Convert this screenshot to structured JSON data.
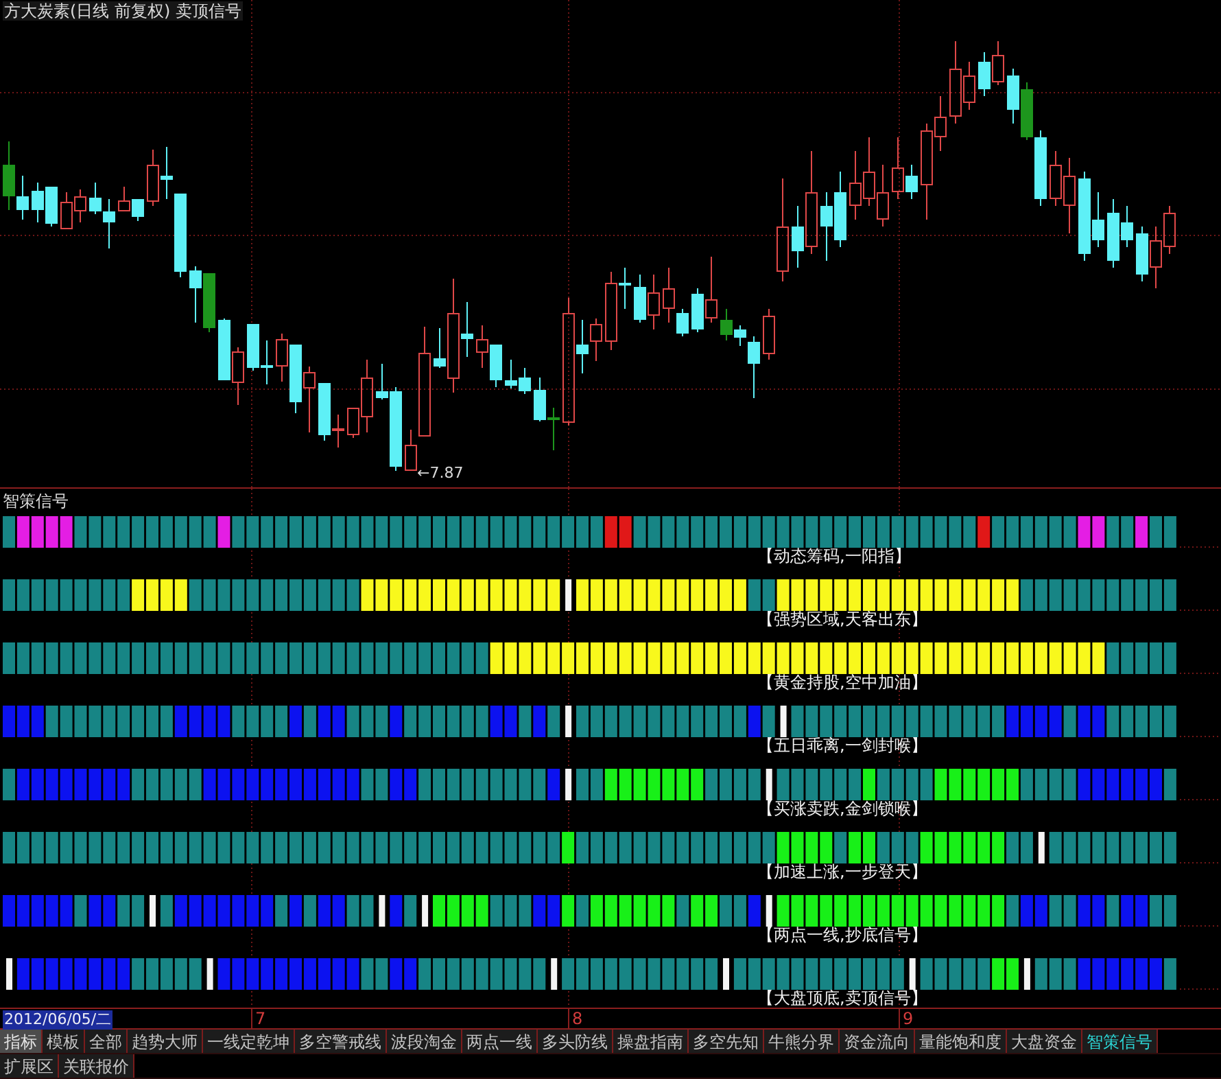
{
  "chart_window": {
    "title": "方大炭素(日线 前复权) 卖顶信号",
    "low_marker": "←7.87"
  },
  "signal_panel": {
    "title": "智策信号",
    "signals": [
      {
        "label": "【动态筹码,一阳指】"
      },
      {
        "label": "【强势区域,天客出东】"
      },
      {
        "label": "【黄金持股,空中加油】"
      },
      {
        "label": "【五日乖离,一剑封喉】"
      },
      {
        "label": "【买涨卖跌,金剑锁喉】"
      },
      {
        "label": "【加速上涨,一步登天】"
      },
      {
        "label": "【两点一线,抄底信号】"
      },
      {
        "label": "【大盘顶底,卖顶信号】"
      }
    ]
  },
  "time_axis": {
    "date": "2012/06/05/二",
    "ticks": [
      "7",
      "8",
      "9"
    ]
  },
  "mode_tabs": [
    {
      "label": "指标",
      "selected": true
    },
    {
      "label": "模板",
      "selected": false
    }
  ],
  "indicator_tabs": [
    {
      "label": "全部",
      "selected": false
    },
    {
      "label": "趋势大师",
      "selected": false
    },
    {
      "label": "一线定乾坤",
      "selected": false
    },
    {
      "label": "多空警戒线",
      "selected": false
    },
    {
      "label": "波段淘金",
      "selected": false
    },
    {
      "label": "两点一线",
      "selected": false
    },
    {
      "label": "多头防线",
      "selected": false
    },
    {
      "label": "操盘指南",
      "selected": false
    },
    {
      "label": "多空先知",
      "selected": false
    },
    {
      "label": "牛熊分界",
      "selected": false
    },
    {
      "label": "资金流向",
      "selected": false
    },
    {
      "label": "量能饱和度",
      "selected": false
    },
    {
      "label": "大盘资金",
      "selected": false
    },
    {
      "label": "智策信号",
      "selected": true
    }
  ],
  "extra_tabs": [
    {
      "label": "扩展区",
      "selected": false
    },
    {
      "label": "关联报价",
      "selected": false
    }
  ]
}
